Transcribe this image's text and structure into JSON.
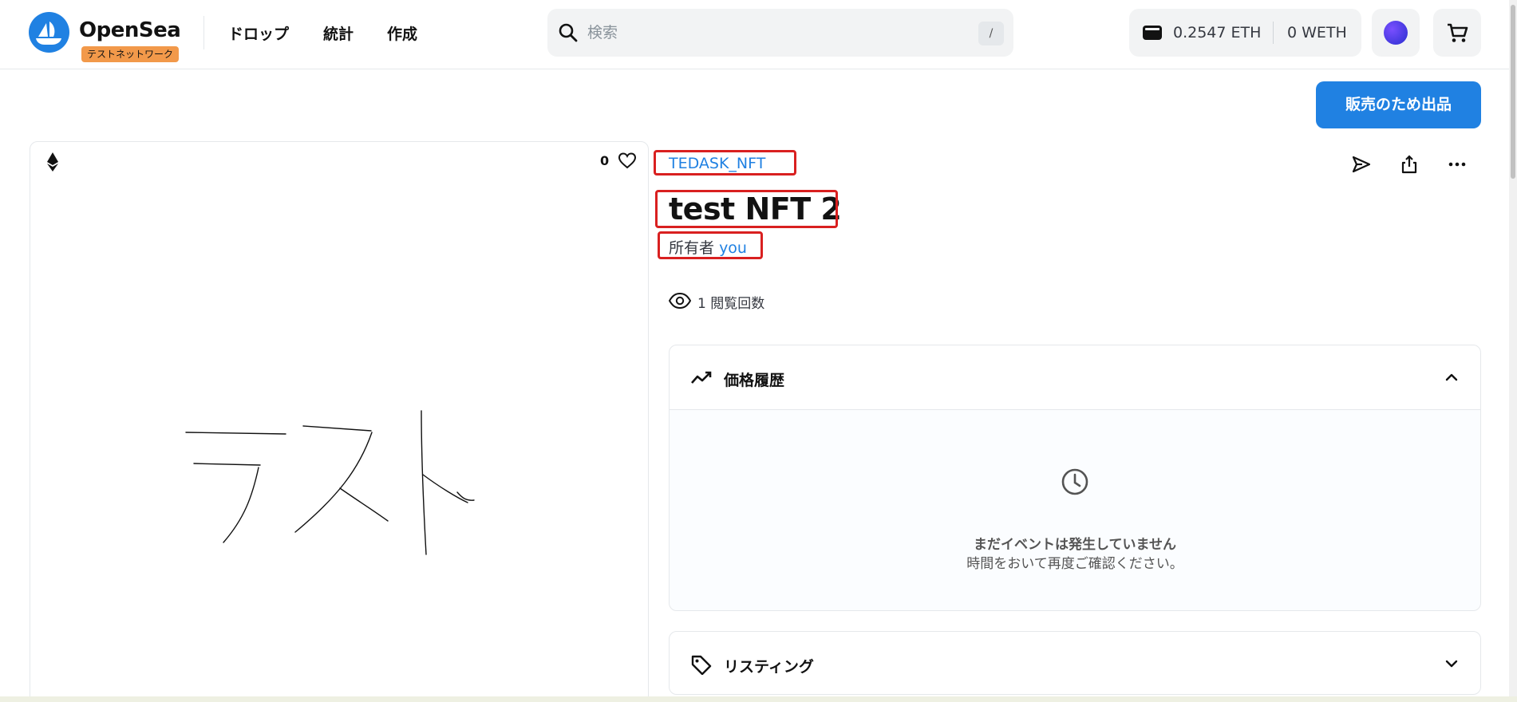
{
  "header": {
    "brand": "OpenSea",
    "network_badge": "テストネットワーク",
    "nav": [
      "ドロップ",
      "統計",
      "作成"
    ],
    "search_placeholder": "検索",
    "search_shortcut": "/",
    "wallet": {
      "eth": "0.2547 ETH",
      "weth": "0 WETH"
    }
  },
  "actions": {
    "sell_label": "販売のため出品"
  },
  "asset": {
    "favorites": "0",
    "artwork_text": "テスト",
    "collection": "TEDASK_NFT",
    "title": "test NFT 2",
    "owner_label": "所有者",
    "owner_name": "you",
    "views": "1 閲覧回数"
  },
  "price_history": {
    "title": "価格履歴",
    "empty_title": "まだイベントは発生していません",
    "empty_sub": "時間をおいて再度ご確認ください。"
  },
  "listings": {
    "title": "リスティング"
  },
  "colors": {
    "accent": "#2081e2",
    "badge": "#f2994a",
    "highlight": "#d92020"
  },
  "icons": [
    "search-icon",
    "wallet-icon",
    "cart-icon",
    "ethereum-icon",
    "heart-icon",
    "send-icon",
    "share-icon",
    "more-icon",
    "eye-icon",
    "chart-line-icon",
    "chevron-up-icon",
    "clock-icon",
    "tag-icon",
    "chevron-down-icon"
  ]
}
